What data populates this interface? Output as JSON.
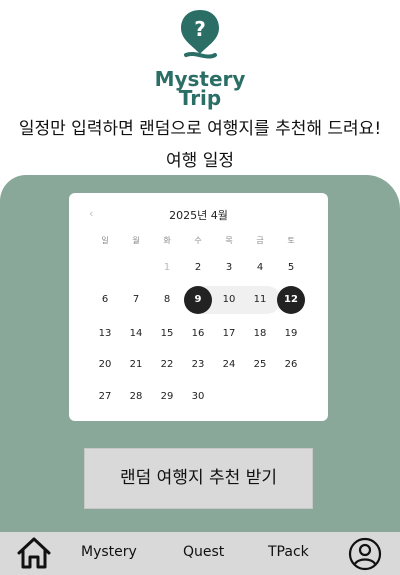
{
  "logo": {
    "line1": "Mystery",
    "line2": "Trip",
    "symbol": "?"
  },
  "tagline": "일정만 입력하면  랜덤으로 여행지를 추천해 드려요!",
  "section_title": "여행 일정",
  "calendar": {
    "prev_symbol": "‹",
    "title": "2025년 4월",
    "weekdays": [
      "일",
      "월",
      "화",
      "수",
      "목",
      "금",
      "토"
    ],
    "days": [
      "1",
      "2",
      "3",
      "4",
      "5",
      "6",
      "7",
      "8",
      "9",
      "10",
      "11",
      "12",
      "13",
      "14",
      "15",
      "16",
      "17",
      "18",
      "19",
      "20",
      "21",
      "22",
      "23",
      "24",
      "25",
      "26",
      "27",
      "28",
      "29",
      "30"
    ],
    "selected_start": "9",
    "selected_end": "12"
  },
  "cta_label": "랜덤 여행지 추천 받기",
  "nav": {
    "mystery": "Mystery",
    "quest": "Quest",
    "tpack": "TPack",
    "home_icon": "home-icon",
    "profile_icon": "user-icon"
  },
  "colors": {
    "brand": "#2b6e66",
    "panel": "#89a89a",
    "selected": "#222222"
  }
}
